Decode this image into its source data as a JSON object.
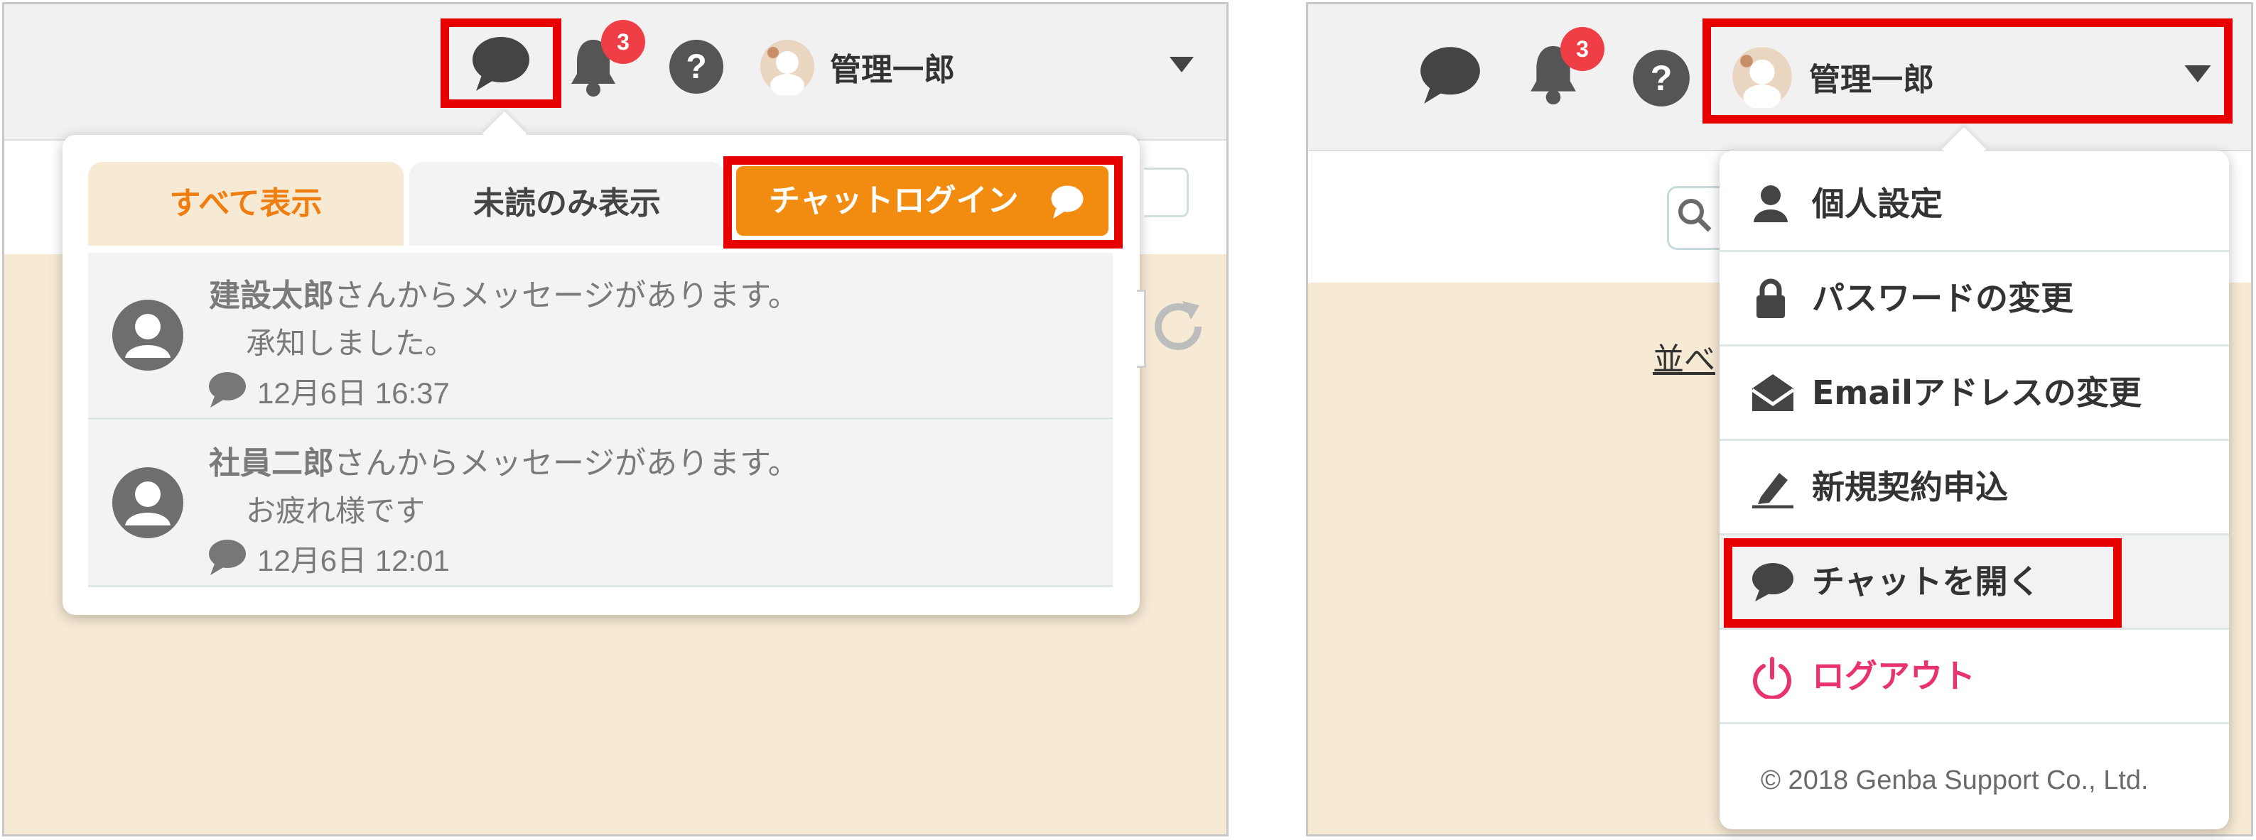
{
  "user": {
    "name": "管理一郎"
  },
  "notifications": {
    "badge_count": "3"
  },
  "left": {
    "tabs": [
      {
        "label": "すべて表示",
        "active": true
      },
      {
        "label": "未読のみ表示",
        "active": false
      }
    ],
    "chat_login_button": "チャットログイン",
    "messages": [
      {
        "sender": "建設太郎",
        "suffix": "さんからメッセージがあります。",
        "body": "承知しました。",
        "time": "12月6日 16:37"
      },
      {
        "sender": "社員二郎",
        "suffix": "さんからメッセージがあります。",
        "body": "お疲れ様です",
        "time": "12月6日 12:01"
      }
    ]
  },
  "right": {
    "background_label": "並べ",
    "menu": [
      {
        "label": "個人設定",
        "icon": "person-icon"
      },
      {
        "label": "パスワードの変更",
        "icon": "lock-icon"
      },
      {
        "label": "Emailアドレスの変更",
        "icon": "envelope-icon"
      },
      {
        "label": "新規契約申込",
        "icon": "pen-icon"
      },
      {
        "label": "チャットを開く",
        "icon": "chat-icon"
      },
      {
        "label": "ログアウト",
        "icon": "power-icon"
      }
    ],
    "copyright": "© 2018 Genba Support Co., Ltd."
  },
  "colors": {
    "accent_orange": "#f28c10",
    "highlight_red": "#e60000",
    "badge_red": "#ef3e45",
    "logout_pink": "#e8336d",
    "beige_bg": "#f6ead4"
  }
}
